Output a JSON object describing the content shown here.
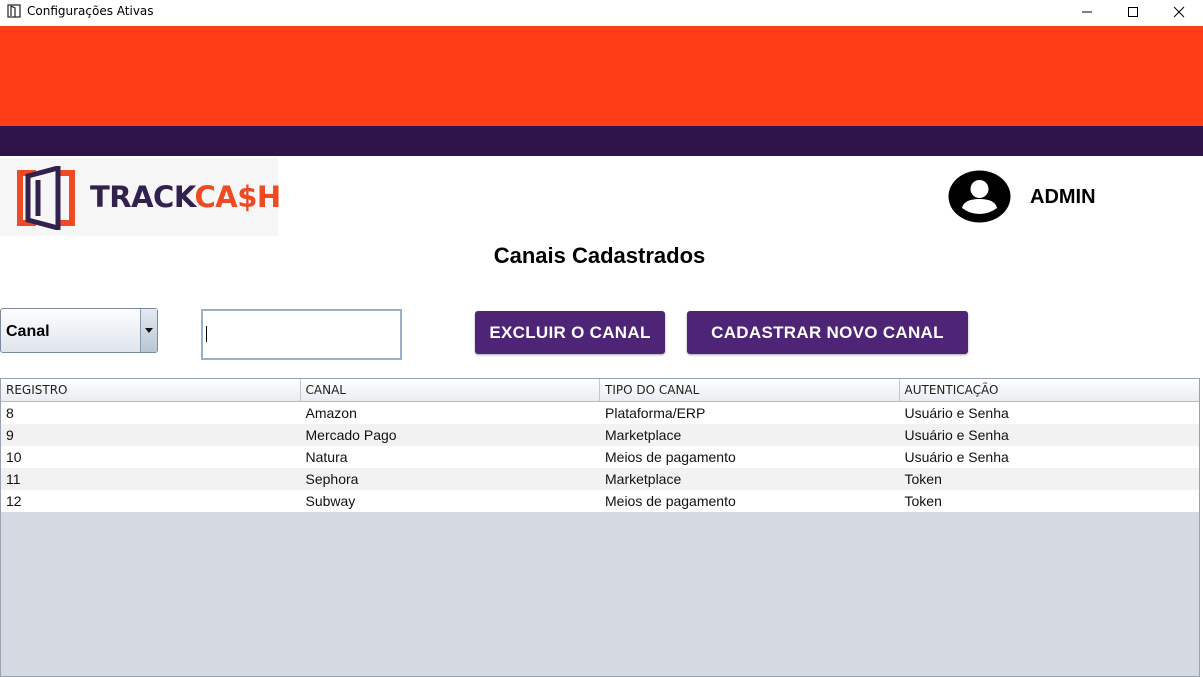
{
  "window": {
    "title": "Configurações Ativas"
  },
  "colors": {
    "banner_orange": "#ff3e17",
    "banner_purple": "#2d1348",
    "button_purple": "#4e2477",
    "logo_dark": "#32204d",
    "logo_orange": "#ef4a23",
    "table_empty": "#d5d9e1"
  },
  "logo": {
    "text_part1": "TRACK",
    "text_part2": "CA$H"
  },
  "user": {
    "name": "ADMIN",
    "icon": "user-circle-icon"
  },
  "page": {
    "title": "Canais Cadastrados"
  },
  "filter": {
    "select_value": "Canal",
    "search_value": ""
  },
  "buttons": {
    "delete_label": "EXCLUIR O CANAL",
    "new_label": "CADASTRAR NOVO CANAL"
  },
  "table": {
    "columns": [
      "REGISTRO",
      "CANAL",
      "TIPO DO CANAL",
      "AUTENTICAÇÃO"
    ],
    "rows": [
      [
        "8",
        "Amazon",
        "Plataforma/ERP",
        "Usuário e Senha"
      ],
      [
        "9",
        "Mercado Pago",
        "Marketplace",
        "Usuário e Senha"
      ],
      [
        "10",
        "Natura",
        "Meios de pagamento",
        "Usuário e Senha"
      ],
      [
        "11",
        "Sephora",
        "Marketplace",
        "Token"
      ],
      [
        "12",
        "Subway",
        "Meios de pagamento",
        "Token"
      ]
    ]
  }
}
